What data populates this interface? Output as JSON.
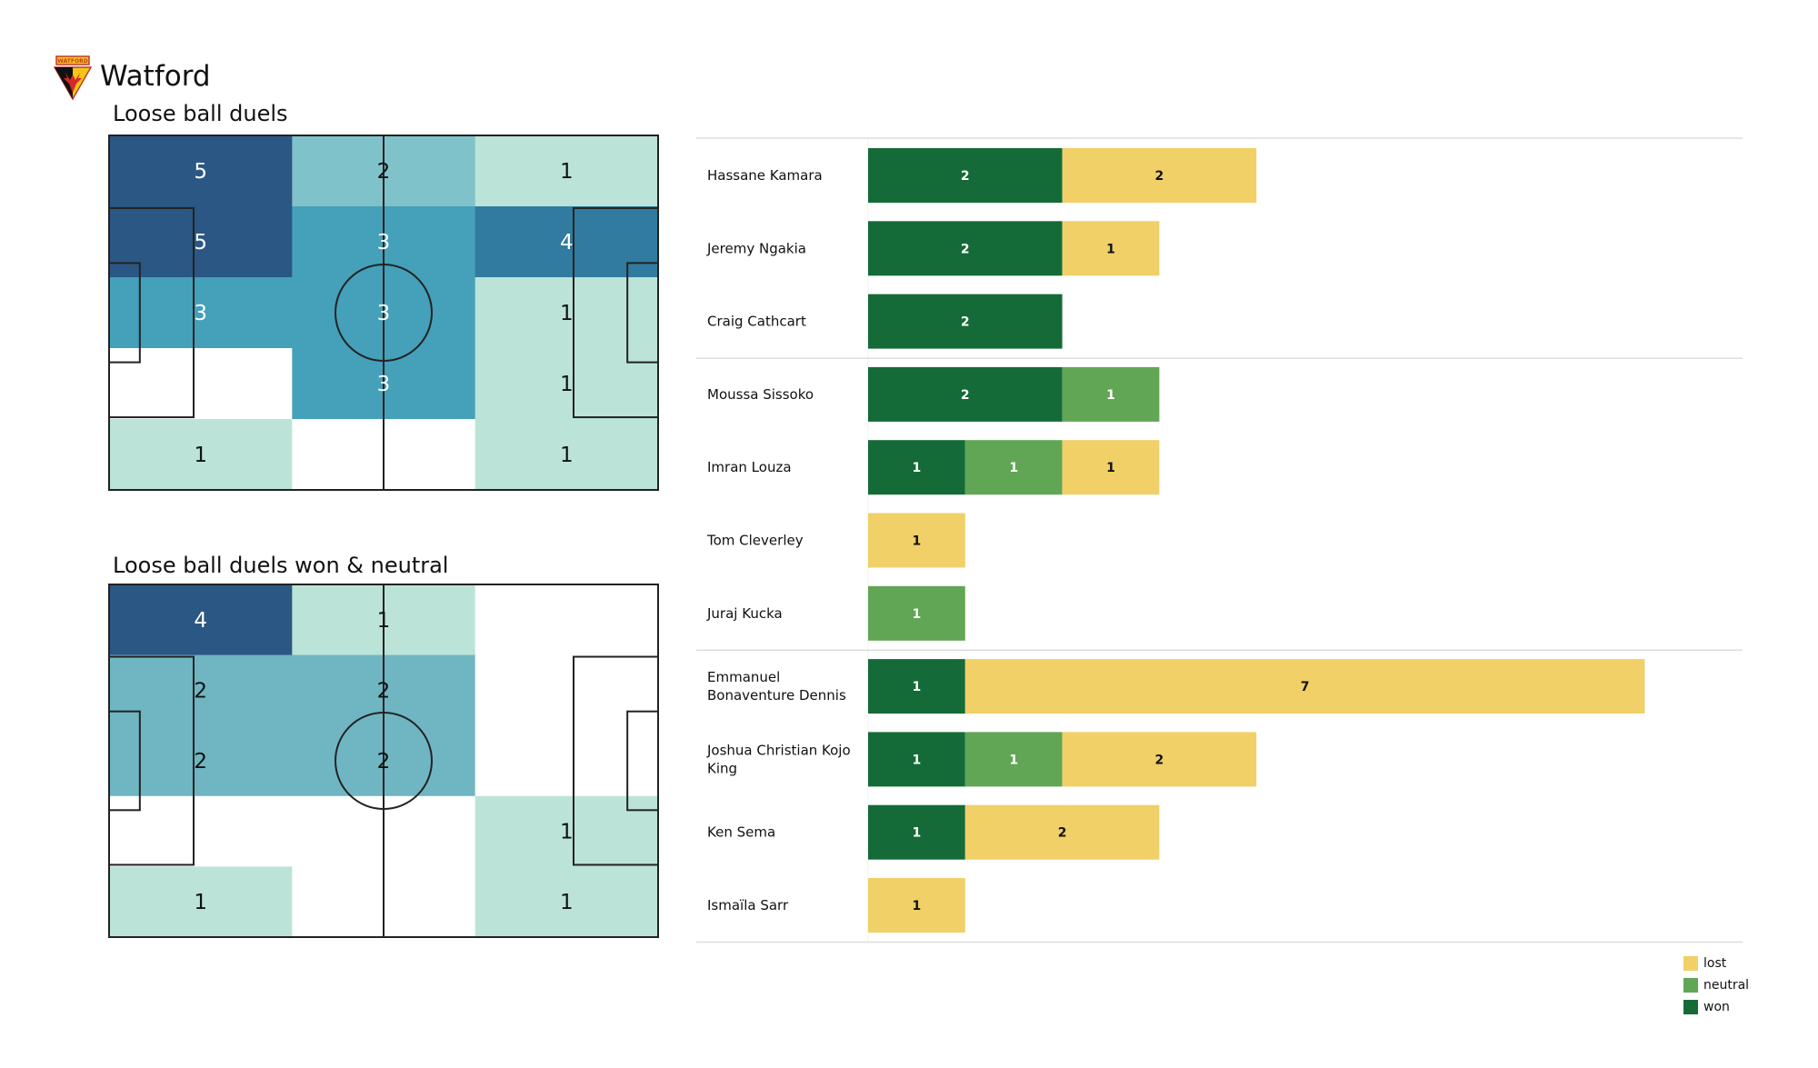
{
  "header": {
    "team_name": "Watford",
    "logo_icon": "watford-crest-icon",
    "logo_text": "WATFORD"
  },
  "colors": {
    "won": "#156b37",
    "neutral": "#61a655",
    "lost": "#f0d067",
    "separator": "#dddddd",
    "pitch_line": "#222222"
  },
  "chart_data": [
    {
      "type": "heatmap",
      "title": "Loose ball duels",
      "grid": {
        "rows": 5,
        "cols": 3
      },
      "values": [
        [
          5,
          2,
          1
        ],
        [
          5,
          3,
          4
        ],
        [
          3,
          3,
          1
        ],
        [
          0,
          3,
          1
        ],
        [
          1,
          0,
          1
        ]
      ],
      "vmax": 5,
      "colormap": [
        "#ffffff",
        "#bbe3d8",
        "#80c2c9",
        "#45a0b9",
        "#317ba0",
        "#2b5784"
      ]
    },
    {
      "type": "heatmap",
      "title": "Loose ball duels won & neutral",
      "grid": {
        "rows": 5,
        "cols": 3
      },
      "values": [
        [
          4,
          1,
          0
        ],
        [
          2,
          2,
          0
        ],
        [
          2,
          2,
          0
        ],
        [
          0,
          0,
          1
        ],
        [
          1,
          0,
          1
        ]
      ],
      "vmax": 4,
      "colormap": [
        "#ffffff",
        "#bbe3d8",
        "#6fb6c2",
        "#4796b5",
        "#2b5784"
      ]
    },
    {
      "type": "bar",
      "orientation": "horizontal-stacked",
      "categories": [
        "Hassane Kamara",
        "Jeremy Ngakia",
        "Craig Cathcart",
        "Moussa Sissoko",
        "Imran Louza",
        "Tom Cleverley",
        "Juraj Kucka",
        "Emmanuel Bonaventure Dennis",
        "Joshua Christian Kojo King",
        "Ken Sema",
        "Ismaïla Sarr"
      ],
      "label_lines": [
        [
          "Hassane Kamara"
        ],
        [
          "Jeremy Ngakia"
        ],
        [
          "Craig Cathcart"
        ],
        [
          "Moussa Sissoko"
        ],
        [
          "Imran Louza"
        ],
        [
          "Tom Cleverley"
        ],
        [
          "Juraj Kucka"
        ],
        [
          "Emmanuel",
          "Bonaventure Dennis"
        ],
        [
          "Joshua Christian Kojo",
          "King"
        ],
        [
          "Ken Sema"
        ],
        [
          "Ismaïla Sarr"
        ]
      ],
      "groups": [
        [
          0,
          1,
          2
        ],
        [
          3,
          4,
          5,
          6
        ],
        [
          7,
          8,
          9,
          10
        ]
      ],
      "series": [
        {
          "name": "won",
          "values": [
            2,
            2,
            2,
            2,
            1,
            0,
            0,
            1,
            1,
            1,
            0
          ]
        },
        {
          "name": "neutral",
          "values": [
            0,
            0,
            0,
            1,
            1,
            0,
            1,
            0,
            1,
            0,
            0
          ]
        },
        {
          "name": "lost",
          "values": [
            2,
            1,
            0,
            0,
            1,
            1,
            0,
            7,
            2,
            2,
            1
          ]
        }
      ],
      "xlim": [
        0,
        9
      ],
      "legend": {
        "position": "bottom-right",
        "entries": [
          "lost",
          "neutral",
          "won"
        ]
      }
    }
  ]
}
